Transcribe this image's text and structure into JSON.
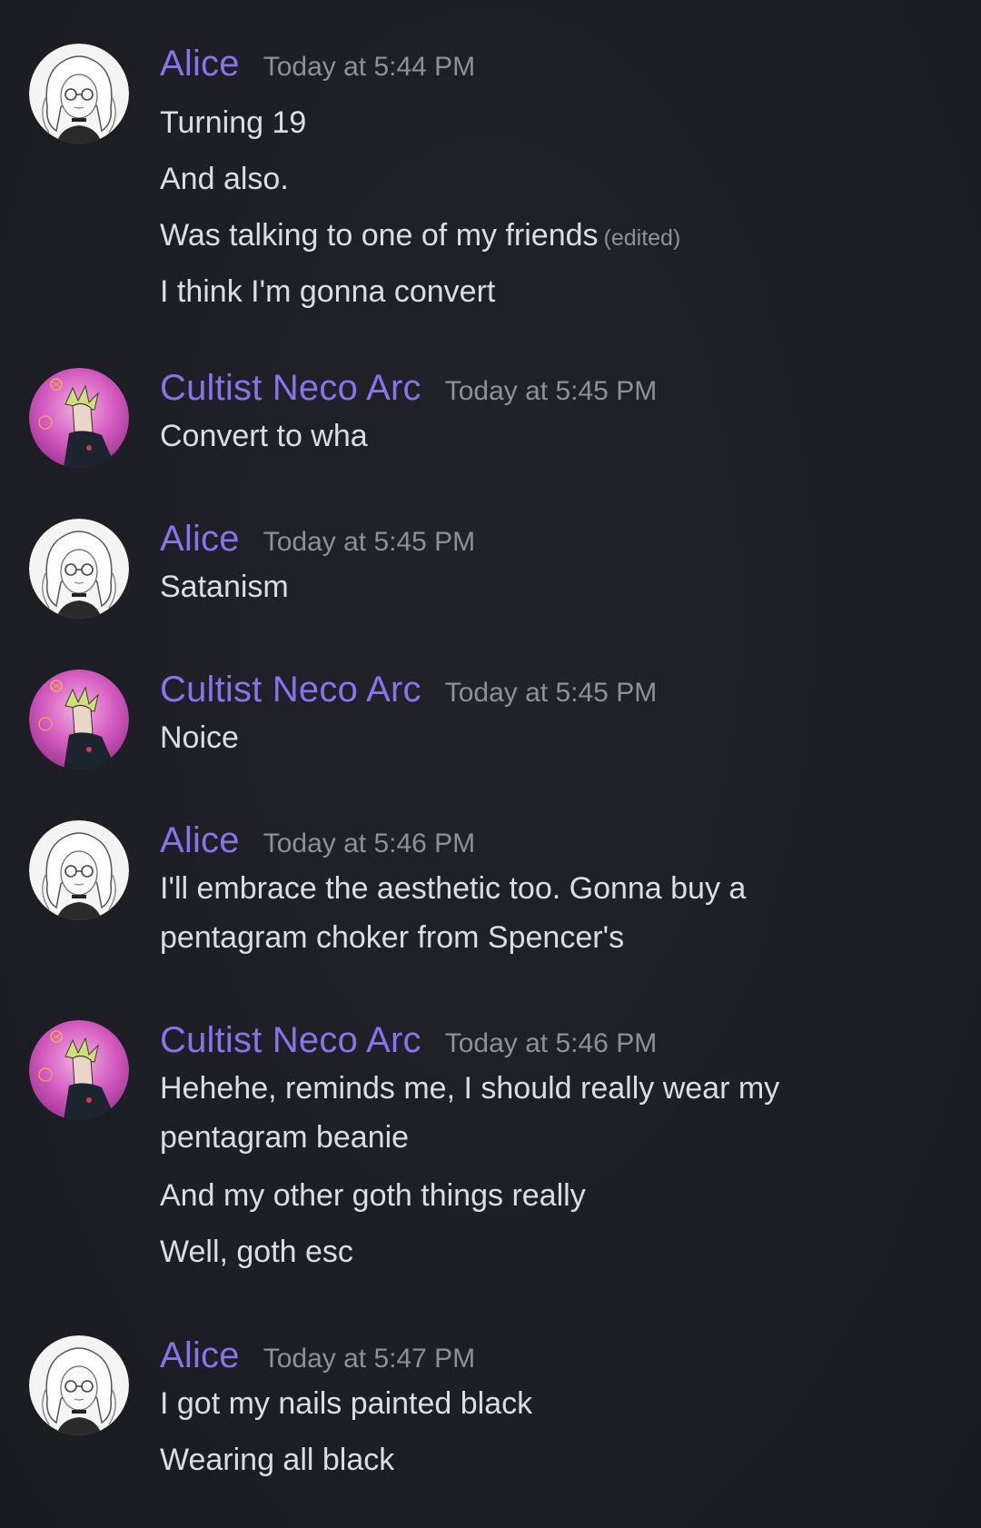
{
  "colors": {
    "background": "#1e1e26",
    "username": "#8a73e8",
    "timestamp": "#8e9097",
    "message_text": "#dcdde2"
  },
  "avatars": {
    "alice": "anime-girl-glasses-avatar",
    "cultist": "pink-anime-boy-avatar"
  },
  "messages": [
    {
      "author": "Alice",
      "time": "Today at 5:44 PM",
      "lines": [
        "Turning 19",
        "And also.",
        "Was talking to one of my friends",
        "I think I'm gonna convert"
      ],
      "edited_label": "(edited)"
    },
    {
      "author": "Cultist Neco Arc",
      "time": "Today at 5:45 PM",
      "lines": [
        "Convert to wha"
      ]
    },
    {
      "author": "Alice",
      "time": "Today at 5:45 PM",
      "lines": [
        "Satanism"
      ]
    },
    {
      "author": "Cultist Neco Arc",
      "time": "Today at 5:45 PM",
      "lines": [
        "Noice"
      ]
    },
    {
      "author": "Alice",
      "time": "Today at 5:46 PM",
      "lines": [
        "I'll embrace the aesthetic too. Gonna buy a pentagram choker from Spencer's"
      ]
    },
    {
      "author": "Cultist Neco Arc",
      "time": "Today at 5:46 PM",
      "lines": [
        "Hehehe, reminds me, I should really wear my pentagram beanie",
        "And my other goth things really",
        "Well, goth esc"
      ]
    },
    {
      "author": "Alice",
      "time": "Today at 5:47 PM",
      "lines": [
        "I got my nails painted black",
        "Wearing all black"
      ]
    }
  ]
}
